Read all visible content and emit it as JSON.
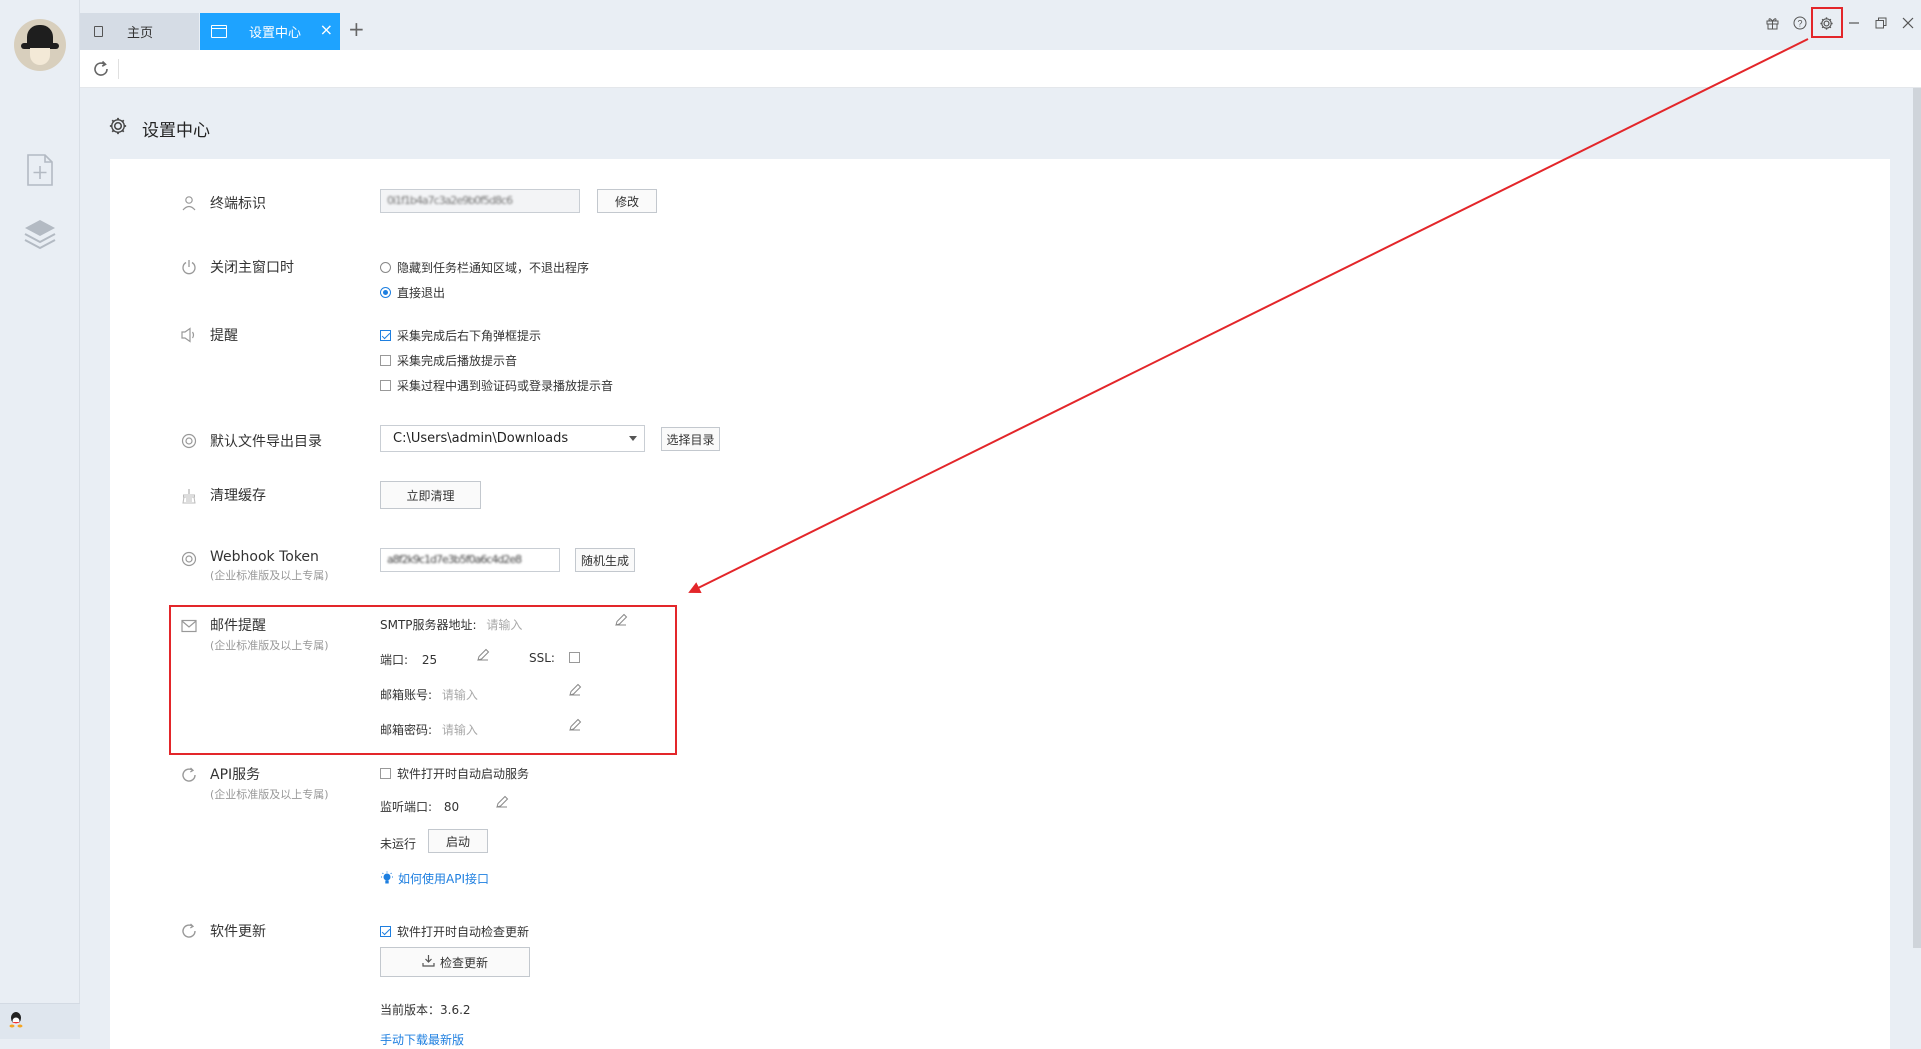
{
  "tabs": {
    "home": "主页",
    "settings": "设置中心",
    "close": "×",
    "add": "+"
  },
  "window_controls": [
    "gift-icon",
    "help-icon",
    "gear-icon",
    "minimize-icon",
    "restore-icon",
    "close-icon"
  ],
  "page": {
    "title": "设置中心"
  },
  "terminal": {
    "label": "终端标识",
    "value": "0i1f1b4a7c3a2e9b0f5d8c6",
    "button": "修改"
  },
  "close_window": {
    "label": "关闭主窗口时",
    "options": [
      {
        "label": "隐藏到任务栏通知区域，不退出程序",
        "selected": false
      },
      {
        "label": "直接退出",
        "selected": true
      }
    ]
  },
  "reminder": {
    "label": "提醒",
    "options": [
      {
        "label": "采集完成后右下角弹框提示",
        "checked": true
      },
      {
        "label": "采集完成后播放提示音",
        "checked": false
      },
      {
        "label": "采集过程中遇到验证码或登录播放提示音",
        "checked": false
      }
    ]
  },
  "export_dir": {
    "label": "默认文件导出目录",
    "value": "C:\\Users\\admin\\Downloads",
    "button": "选择目录"
  },
  "cache": {
    "label": "清理缓存",
    "button": "立即清理"
  },
  "webhook": {
    "label": "Webhook Token",
    "sub": "(企业标准版及以上专属)",
    "value": "a8f2k9c1d7e3b5f0a6c4d2e8",
    "button": "随机生成"
  },
  "mail": {
    "label": "邮件提醒",
    "sub": "(企业标准版及以上专属)",
    "smtp_label": "SMTP服务器地址:",
    "smtp_placeholder": "请输入",
    "port_label": "端口:",
    "port_value": "25",
    "ssl_label": "SSL:",
    "account_label": "邮箱账号:",
    "account_placeholder": "请输入",
    "password_label": "邮箱密码:",
    "password_placeholder": "请输入"
  },
  "api": {
    "label": "API服务",
    "sub": "(企业标准版及以上专属)",
    "autostart": "软件打开时自动启动服务",
    "port_label": "监听端口:",
    "port_value": "80",
    "status": "未运行",
    "start_button": "启动",
    "help_link": "如何使用API接口"
  },
  "update": {
    "label": "软件更新",
    "autocheck": "软件打开时自动检查更新",
    "check_button": "检查更新",
    "version_label": "当前版本：",
    "version": "3.6.2",
    "manual_link": "手动下载最新版"
  },
  "colors": {
    "accent": "#1ea3ff",
    "highlight": "#e3262a",
    "link": "#1e7fe0"
  }
}
